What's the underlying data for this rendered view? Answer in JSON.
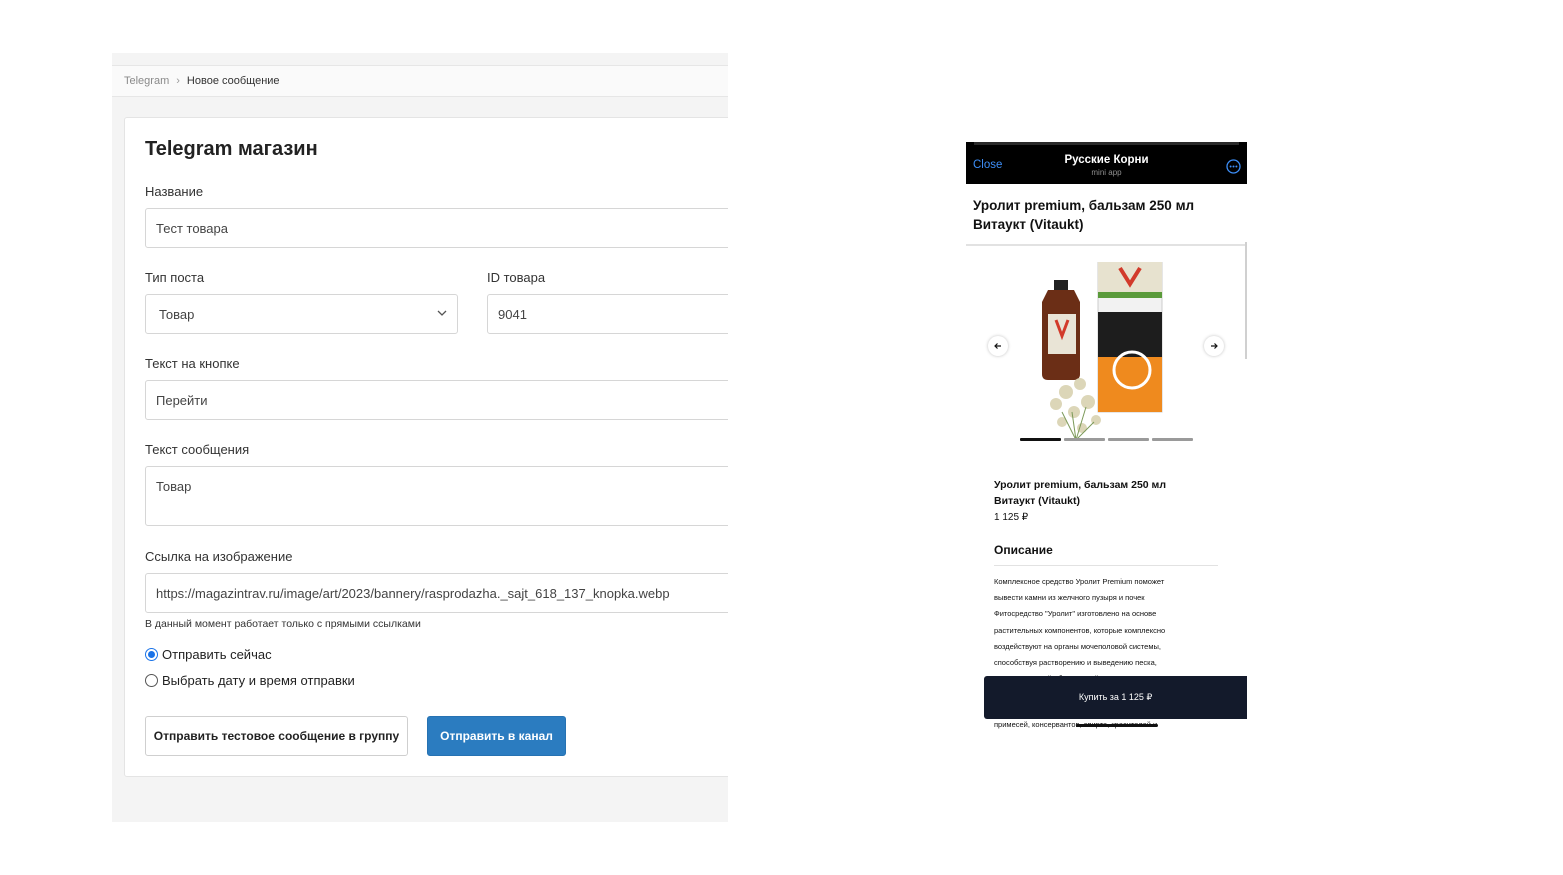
{
  "admin": {
    "breadcrumb": {
      "root": "Telegram",
      "separator": "›",
      "current": "Новое сообщение"
    },
    "title": "Telegram магазин",
    "fields": {
      "name": {
        "label": "Название",
        "value": "Тест товара"
      },
      "post_type": {
        "label": "Тип поста",
        "value": "Товар"
      },
      "product_id": {
        "label": "ID товара",
        "value": "9041"
      },
      "button_text": {
        "label": "Текст на кнопке",
        "value": "Перейти"
      },
      "message_text": {
        "label": "Текст сообщения",
        "value": "Товар"
      },
      "image_link": {
        "label": "Ссылка на изображение",
        "value": "https://magazintrav.ru/image/art/2023/bannery/rasprodazha._sajt_618_137_knopka.webp",
        "hint": "В данный момент работает только с прямыми ссылками"
      }
    },
    "schedule": {
      "send_now": "Отправить сейчас",
      "pick_date": "Выбрать дату и время отправки",
      "selected": "send_now"
    },
    "buttons": {
      "test": "Отправить тестовое сообщение в группу",
      "send": "Отправить в канал"
    },
    "colors": {
      "primary": "#2b7cc0",
      "radio": "#1a73e8"
    }
  },
  "phone": {
    "close": "Close",
    "app_title": "Русские Корни",
    "app_subtitle": "mini app",
    "product_title": "Уролит premium, бальзам 250 мл Витаукт (Vitaukt)",
    "gallery": {
      "slides": 4,
      "active": 0
    },
    "info_title": "Уролит premium, бальзам 250 мл Витаукт (Vitaukt)",
    "price": "1 125 ₽",
    "description_heading": "Описание",
    "description_lines": [
      "Комплексное средство Уролит Premium поможет",
      "вывести камни из желчного пузыря и почек",
      "Фитосредство \"Уролит\" изготовлено на основе",
      "растительных компонентов, которые комплексно",
      "воздействуют на органы мочеполовой системы,",
      "способствуя растворению и выведению песка,",
      "мочевых камней образований. В составе"
    ],
    "description_tail": "примесей, консервантов, спирта, красителей и",
    "buy_button": "Купить за 1 125 ₽",
    "colors": {
      "link": "#3d8ef7",
      "buy_bar": "#131a2b"
    }
  }
}
